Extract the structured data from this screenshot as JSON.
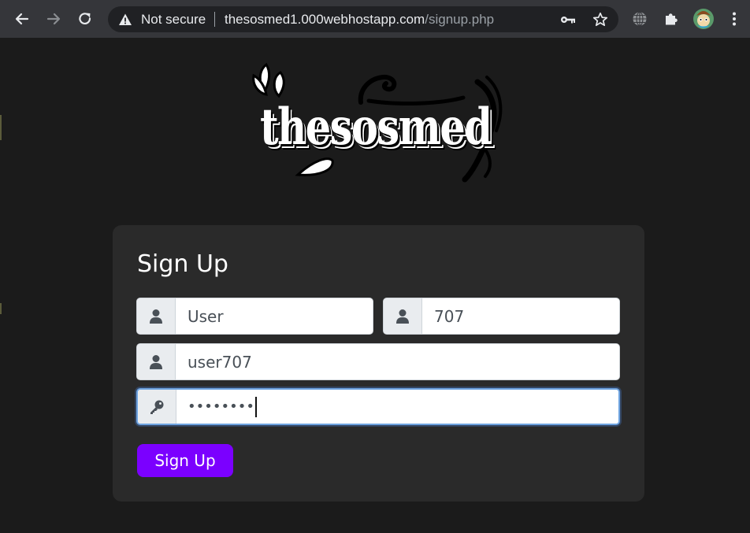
{
  "browser": {
    "security_label": "Not secure",
    "url_host": "thesosmed1.000webhostapp.com",
    "url_path": "/signup.php"
  },
  "logo": {
    "text": "thesosmed"
  },
  "form": {
    "title": "Sign Up",
    "first_name": {
      "value": "User",
      "icon": "user-icon"
    },
    "last_name": {
      "value": "707",
      "icon": "user-icon"
    },
    "username": {
      "value": "user707",
      "icon": "user-icon"
    },
    "password": {
      "masked": "••••••••",
      "icon": "key-icon"
    },
    "submit_label": "Sign Up"
  },
  "colors": {
    "page_bg": "#1b1b1b",
    "card_bg": "#2a2a2a",
    "accent": "#7b00ff"
  }
}
